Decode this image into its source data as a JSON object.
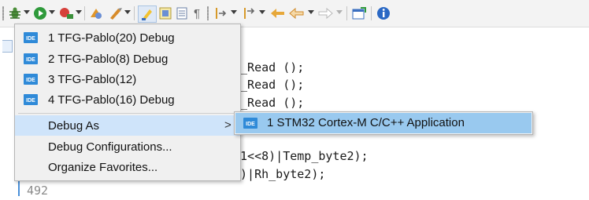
{
  "toolbar": {
    "icons": [
      "debug-bug-icon",
      "run-icon",
      "external-tools-icon",
      "coverage-icon",
      "build-icon",
      "toggle-mark-occurrences-icon",
      "block-selection-icon",
      "show-whitespace-icon",
      "pilcrow-icon",
      "next-annotation-icon",
      "previous-annotation-icon",
      "back-icon",
      "forward-icon",
      "new-window-icon",
      "info-icon"
    ]
  },
  "editor": {
    "line_number": "492",
    "code_lines": [
      "2_Read ();",
      "2_Read ();",
      "2_Read ();",
      "",
      "",
      "e1<<8)|Temp_byte2);",
      "3)|Rh_byte2);"
    ]
  },
  "context_menu": {
    "items": [
      {
        "label": "1 TFG-Pablo(20) Debug",
        "icon": "ide-launch-icon"
      },
      {
        "label": "2 TFG-Pablo(8) Debug",
        "icon": "ide-launch-icon"
      },
      {
        "label": "3 TFG-Pablo(12)",
        "icon": "ide-launch-icon"
      },
      {
        "label": "4 TFG-Pablo(16) Debug",
        "icon": "ide-launch-icon"
      },
      {
        "label": "Debug As",
        "submenu_arrow": ">"
      },
      {
        "label": "Debug Configurations..."
      },
      {
        "label": "Organize Favorites..."
      }
    ]
  },
  "submenu": {
    "items": [
      {
        "label": "1 STM32 Cortex-M C/C++ Application",
        "icon": "ide-launch-icon"
      }
    ]
  },
  "colors": {
    "menu_background": "#f0f0f0",
    "active_item": "#cfe4fa",
    "submenu_highlight": "#99c9ef",
    "ide_badge": "#2f8ad8"
  }
}
